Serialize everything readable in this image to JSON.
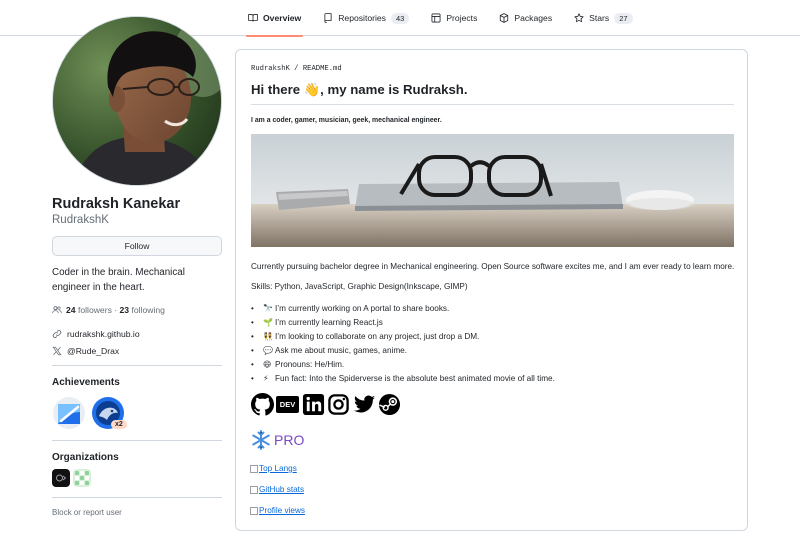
{
  "nav": {
    "tabs": [
      {
        "label": "Overview",
        "icon": "book-icon",
        "active": true
      },
      {
        "label": "Repositories",
        "icon": "repo-icon",
        "count": "43"
      },
      {
        "label": "Projects",
        "icon": "table-icon"
      },
      {
        "label": "Packages",
        "icon": "package-icon"
      },
      {
        "label": "Stars",
        "icon": "star-icon",
        "count": "27"
      }
    ]
  },
  "profile": {
    "fullname": "Rudraksh Kanekar",
    "login": "RudrakshK",
    "follow_label": "Follow",
    "bio": "Coder in the brain. Mechanical engineer in the heart.",
    "followers_count": "24",
    "followers_label": "followers",
    "separator": "·",
    "following_count": "23",
    "following_label": "following",
    "website": "rudrakshk.github.io",
    "twitter": "@Rude_Drax"
  },
  "achievements": {
    "title": "Achievements",
    "badges": [
      {
        "name": "achievement-badge-1"
      },
      {
        "name": "achievement-badge-2",
        "multiplier": "x2"
      }
    ]
  },
  "organizations": {
    "title": "Organizations"
  },
  "block_report": "Block or report user",
  "readme": {
    "path_owner": "RudrakshK",
    "path_sep": "/",
    "path_file": "README.md",
    "heading": "Hi there 👋, my name is Rudraksh.",
    "subtitle": "I am a coder, gamer, musician, geek, mechanical engineer.",
    "intro": "Currently pursuing bachelor degree in Mechanical engineering. Open Source software excites me, and I am ever ready to learn more.",
    "skills": "Skills: Python, JavaScript, Graphic Design(Inkscape, GIMP)",
    "bullets": [
      {
        "emoji": "🔭",
        "text": "I’m currently working on A portal to share books."
      },
      {
        "emoji": "🌱",
        "text": "I’m currently learning React.js"
      },
      {
        "emoji": "👯",
        "text": "I’m looking to collaborate on any project, just drop a DM."
      },
      {
        "emoji": "💬",
        "text": "Ask me about music, games, anime."
      },
      {
        "emoji": "😄",
        "text": "Pronouns: He/Him."
      },
      {
        "emoji": "⚡",
        "text": "Fun fact: Into the Spiderverse is the absolute best animated movie of all time."
      }
    ],
    "dev_text": "DEV",
    "pro_text": "PRO",
    "img_links": [
      "Top Langs",
      "GitHub stats",
      "Profile views"
    ]
  },
  "colors": {
    "accent_underline": "#fd8c73",
    "link": "#0969da",
    "pro": "#7b48c2"
  }
}
